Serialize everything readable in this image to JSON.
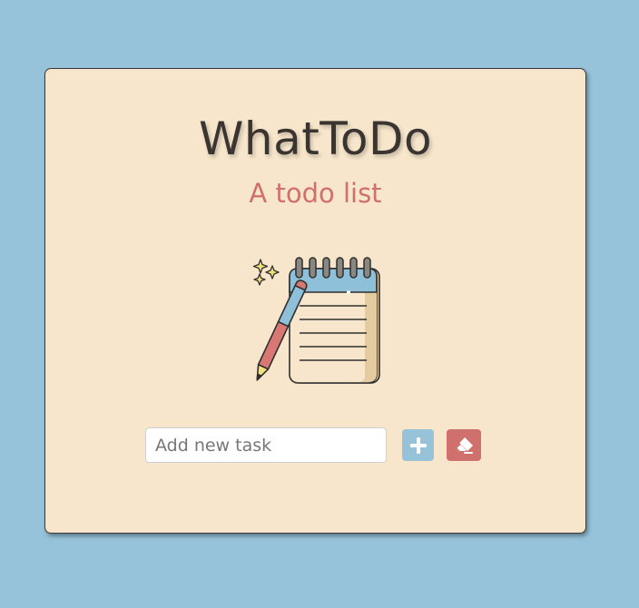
{
  "app": {
    "title": "WhatToDo",
    "subtitle": "A todo list"
  },
  "illustration": {
    "icon": "notepad-with-pencil-icon"
  },
  "task_input": {
    "placeholder": "Add new task",
    "value": ""
  },
  "actions": {
    "add_icon": "plus-icon",
    "clear_icon": "eraser-icon"
  },
  "colors": {
    "background": "#96c2da",
    "card": "#f7e6cb",
    "title": "#3a3531",
    "subtitle": "#d0706c",
    "add_button": "#96c2da",
    "clear_button": "#d0706c"
  }
}
